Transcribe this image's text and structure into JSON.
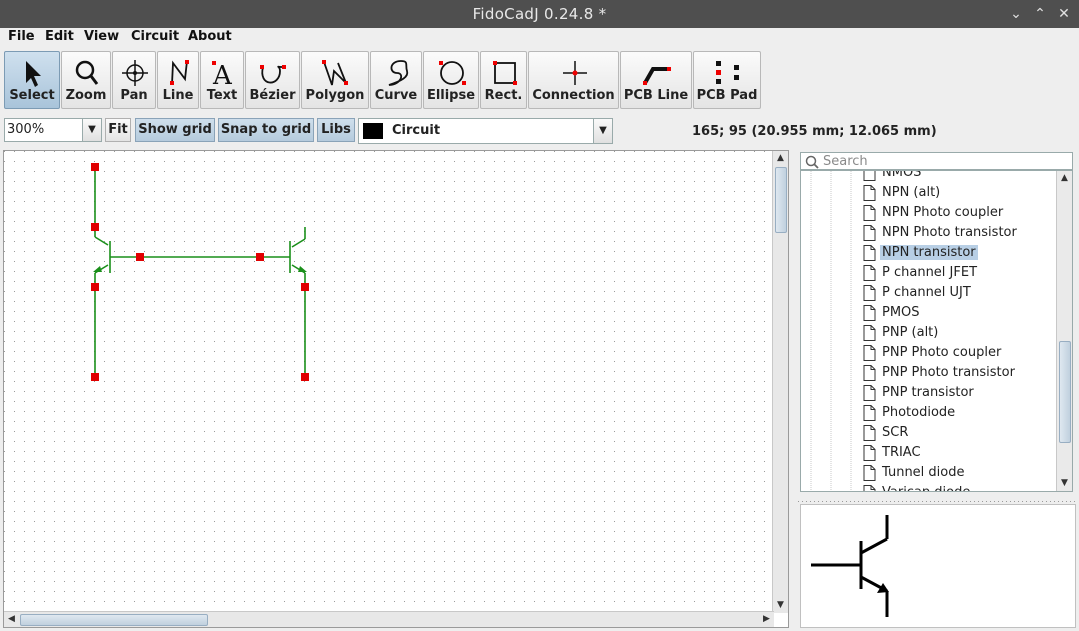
{
  "window": {
    "title": "FidoCadJ 0.24.8  *"
  },
  "menu": [
    "File",
    "Edit",
    "View",
    "Circuit",
    "About"
  ],
  "toolbar": [
    {
      "label": "Select",
      "icon": "arrow-pointer-icon",
      "active": true
    },
    {
      "label": "Zoom",
      "icon": "magnifier-icon"
    },
    {
      "label": "Pan",
      "icon": "pan-crosshair-icon"
    },
    {
      "label": "Line",
      "icon": "line-tool-icon"
    },
    {
      "label": "Text",
      "icon": "text-tool-icon"
    },
    {
      "label": "Bézier",
      "icon": "bezier-tool-icon"
    },
    {
      "label": "Polygon",
      "icon": "polygon-tool-icon"
    },
    {
      "label": "Curve",
      "icon": "curve-tool-icon"
    },
    {
      "label": "Ellipse",
      "icon": "ellipse-tool-icon"
    },
    {
      "label": "Rect.",
      "icon": "rectangle-tool-icon"
    },
    {
      "label": "Connection",
      "icon": "connection-tool-icon"
    },
    {
      "label": "PCB Line",
      "icon": "pcb-line-tool-icon"
    },
    {
      "label": "PCB Pad",
      "icon": "pcb-pad-tool-icon"
    }
  ],
  "options": {
    "zoom": "300%",
    "fit": "Fit",
    "show_grid": "Show grid",
    "snap_to_grid": "Snap to grid",
    "libs": "Libs",
    "layer": "Circuit",
    "layer_color": "#000000",
    "coordinates": "165; 95 (20.955 mm; 12.065 mm)"
  },
  "library": {
    "search_placeholder": "Search",
    "items": [
      "NMOS",
      "NPN (alt)",
      "NPN Photo coupler",
      "NPN Photo transistor",
      "NPN transistor",
      "P channel JFET",
      "P channel UJT",
      "PMOS",
      "PNP (alt)",
      "PNP Photo coupler",
      "PNP Photo transistor",
      "PNP transistor",
      "Photodiode",
      "SCR",
      "TRIAC",
      "Tunnel diode",
      "Varicap diode"
    ],
    "selected": "NPN transistor"
  },
  "colors": {
    "wire": "#1a8f1a",
    "handle": "#e00000",
    "selection": "#b8cfe5"
  }
}
